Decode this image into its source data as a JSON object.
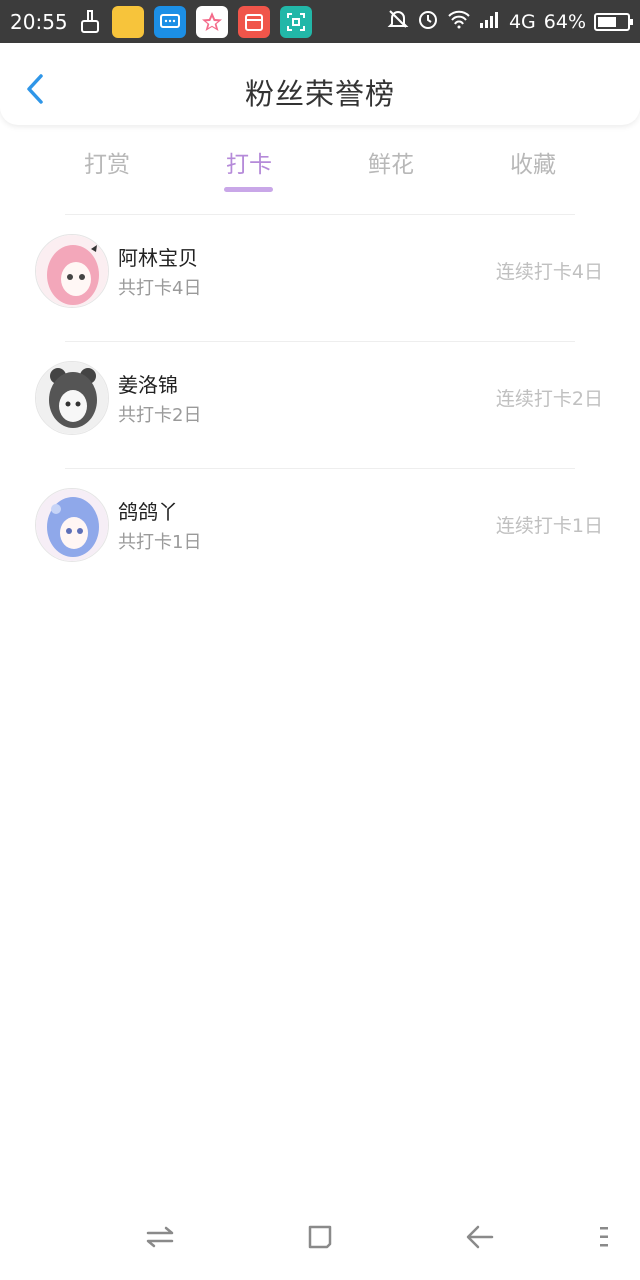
{
  "status_bar": {
    "time": "20:55",
    "network": "4G",
    "battery": "64%",
    "battery_level": 0.64
  },
  "header": {
    "title": "粉丝荣誉榜"
  },
  "tabs": [
    {
      "label": "打赏",
      "active": false
    },
    {
      "label": "打卡",
      "active": true
    },
    {
      "label": "鲜花",
      "active": false
    },
    {
      "label": "收藏",
      "active": false
    }
  ],
  "fans": [
    {
      "name": "阿林宝贝",
      "total": "共打卡4日",
      "streak": "连续打卡4日",
      "avatar_colors": [
        "#f6c9d2",
        "#e86f8e"
      ]
    },
    {
      "name": "姜洛锦",
      "total": "共打卡2日",
      "streak": "连续打卡2日",
      "avatar_colors": [
        "#e9e9e9",
        "#5a5a5a"
      ]
    },
    {
      "name": "鸽鸽丫",
      "total": "共打卡1日",
      "streak": "连续打卡1日",
      "avatar_colors": [
        "#dfe8fb",
        "#6f8fe0"
      ]
    }
  ],
  "colors": {
    "accent": "#b58ad9",
    "back_icon": "#2f96e8",
    "status_bg": "#3c3c3c"
  }
}
